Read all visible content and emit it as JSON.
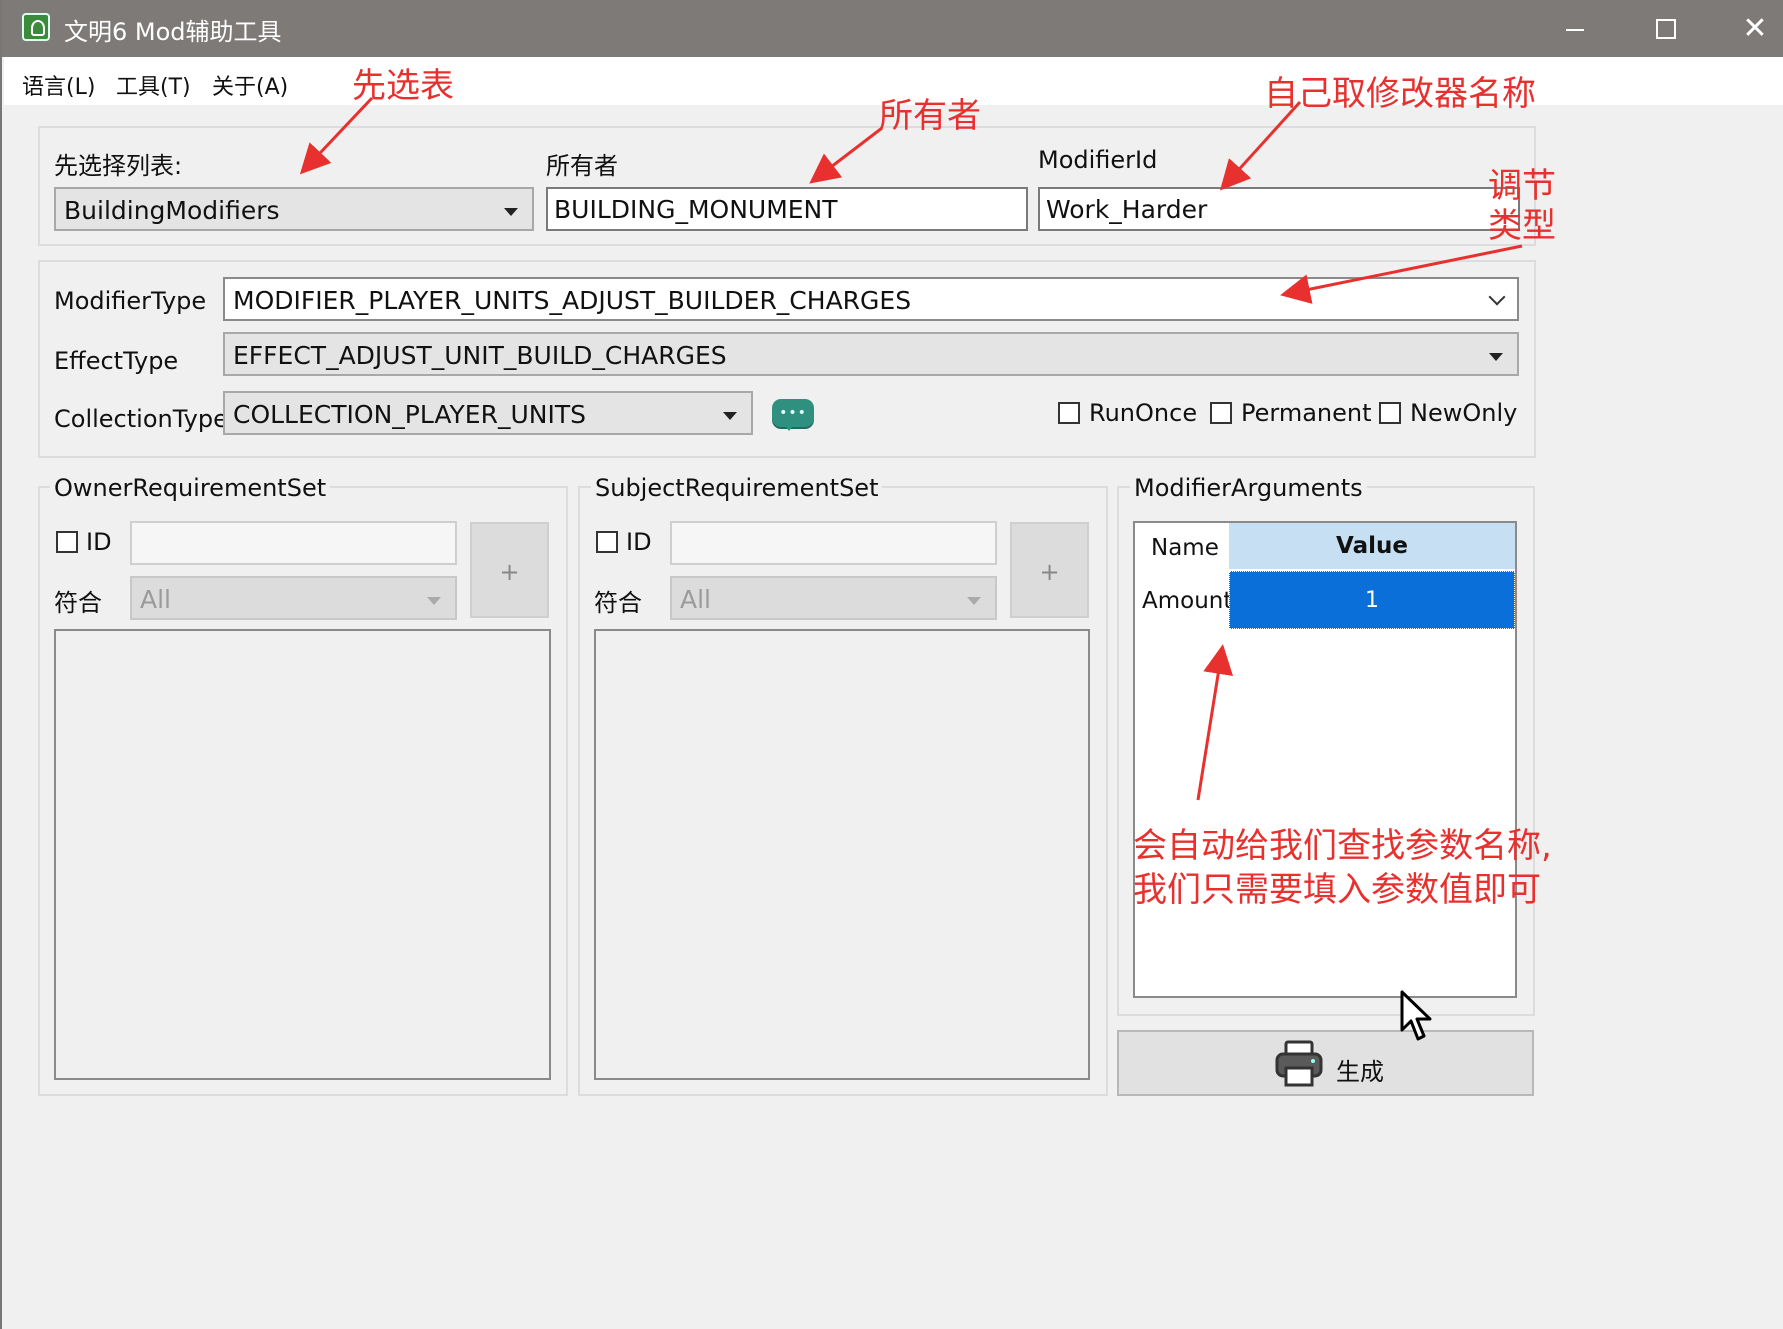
{
  "window": {
    "title": "文明6 Mod辅助工具",
    "controls": {
      "minimize": "",
      "maximize": "",
      "close": "✕"
    }
  },
  "menu": {
    "items": [
      "语言(L)",
      "工具(T)",
      "关于(A)"
    ]
  },
  "top_group": {
    "list_label": "先选择列表:",
    "list_value": "BuildingModifiers",
    "owner_label": "所有者",
    "owner_value": "BUILDING_MONUMENT",
    "modifier_id_label": "ModifierId",
    "modifier_id_value": "Work_Harder"
  },
  "type_group": {
    "modifier_type_label": "ModifierType",
    "modifier_type_value": "MODIFIER_PLAYER_UNITS_ADJUST_BUILDER_CHARGES",
    "effect_type_label": "EffectType",
    "effect_type_value": "EFFECT_ADJUST_UNIT_BUILD_CHARGES",
    "collection_type_label": "CollectionType",
    "collection_type_value": "COLLECTION_PLAYER_UNITS",
    "checkboxes": {
      "run_once": "RunOnce",
      "permanent": "Permanent",
      "new_only": "NewOnly"
    }
  },
  "owner_req": {
    "title": "OwnerRequirementSet",
    "id_label": "ID",
    "match_label": "符合",
    "match_value": "All",
    "add": "+"
  },
  "subject_req": {
    "title": "SubjectRequirementSet",
    "id_label": "ID",
    "match_label": "符合",
    "match_value": "All",
    "add": "+"
  },
  "args": {
    "title": "ModifierArguments",
    "col_name": "Name",
    "col_value": "Value",
    "rows": [
      {
        "name": "Amount",
        "value": "1"
      }
    ]
  },
  "generate_button": "生成",
  "annotations": {
    "select_table": "先选表",
    "owner": "所有者",
    "name_modifier": "自己取修改器名称",
    "adjust_type_1": "调节",
    "adjust_type_2": "类型",
    "auto_line1": "会自动给我们查找参数名称,",
    "auto_line2": "我们只需要填入参数值即可"
  },
  "colors": {
    "annotation": "#e8302e",
    "selected_cell": "#0a6fd8",
    "header_cell": "#c6dff3",
    "title_bar": "#7d7a78"
  }
}
